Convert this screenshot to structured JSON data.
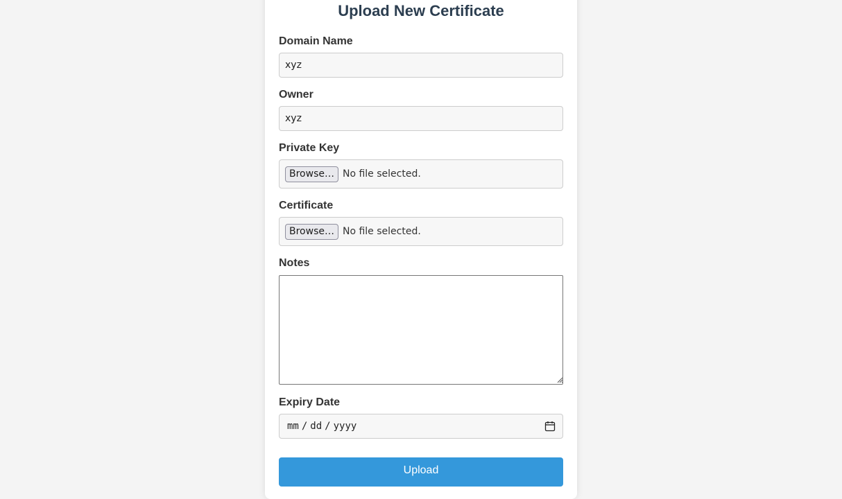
{
  "form": {
    "title": "Upload New Certificate",
    "domain": {
      "label": "Domain Name",
      "value": "xyz"
    },
    "owner": {
      "label": "Owner",
      "value": "xyz"
    },
    "private_key": {
      "label": "Private Key",
      "button": "Browse…",
      "status": "No file selected."
    },
    "certificate": {
      "label": "Certificate",
      "button": "Browse…",
      "status": "No file selected."
    },
    "notes": {
      "label": "Notes",
      "value": ""
    },
    "expiry": {
      "label": "Expiry Date",
      "month": "mm",
      "day": "dd",
      "year": "yyyy",
      "separator": "/"
    },
    "submit_label": "Upload"
  },
  "colors": {
    "accent": "#3498db",
    "title": "#2c3e50",
    "background": "#f4f4f4"
  },
  "icons": {
    "date_picker": "calendar-icon",
    "textarea_resize": "resize-grip-icon"
  }
}
